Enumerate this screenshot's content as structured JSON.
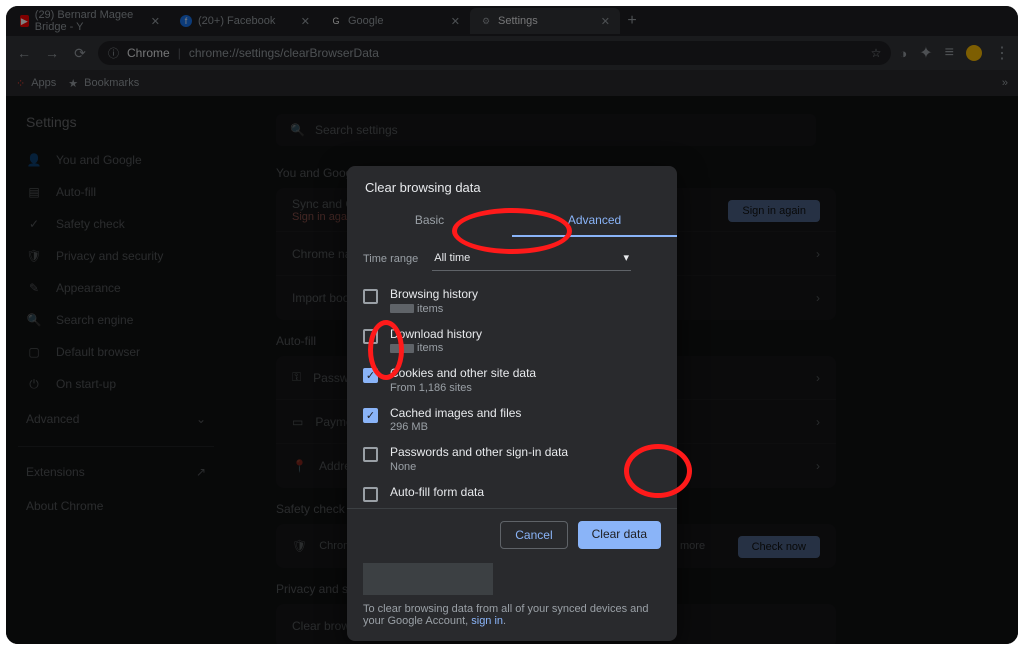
{
  "tabs": [
    {
      "favicon": "yt",
      "title": "(29) Bernard Magee Bridge - Y"
    },
    {
      "favicon": "fb",
      "title": "(20+) Facebook"
    },
    {
      "favicon": "g",
      "title": "Google"
    },
    {
      "favicon": "gear",
      "title": "Settings",
      "active": true
    }
  ],
  "omnibox": {
    "chrome_label": "Chrome",
    "path": "chrome://settings/clearBrowserData"
  },
  "bookmarks": {
    "apps": "Apps",
    "bookmarks": "Bookmarks"
  },
  "settings": {
    "title": "Settings",
    "sidebar": [
      {
        "icon": "person",
        "label": "You and Google"
      },
      {
        "icon": "autofill",
        "label": "Auto-fill"
      },
      {
        "icon": "shield",
        "label": "Safety check"
      },
      {
        "icon": "privacy",
        "label": "Privacy and security"
      },
      {
        "icon": "appearance",
        "label": "Appearance"
      },
      {
        "icon": "search",
        "label": "Search engine"
      },
      {
        "icon": "default",
        "label": "Default browser"
      },
      {
        "icon": "onstart",
        "label": "On start-up"
      }
    ],
    "advanced": "Advanced",
    "extensions": "Extensions",
    "about": "About Chrome",
    "search_placeholder": "Search settings",
    "sections": {
      "you": "You and Google",
      "sync": "Sync and Google services",
      "signin": "Sign in again",
      "chrome_name": "Chrome name and picture",
      "import": "Import bookmarks and settings",
      "sign_in_again_btn": "Sign in again",
      "autofill": "Auto-fill",
      "passwords": "Passwords",
      "payments": "Payment methods",
      "addresses": "Addresses and more",
      "safety": "Safety check",
      "chrome_can": "Chrome can help keep you safe from data breaches, bad extensions, and more",
      "check_now": "Check now",
      "privacy": "Privacy and security",
      "clear_browsing": "Clear browsing data"
    }
  },
  "modal": {
    "title": "Clear browsing data",
    "tabs": {
      "basic": "Basic",
      "advanced": "Advanced"
    },
    "time_range_label": "Time range",
    "time_range_value": "All time",
    "options": [
      {
        "checked": false,
        "l1": "Browsing history",
        "l2_items": "items",
        "bar": true
      },
      {
        "checked": false,
        "l1": "Download history",
        "l2_items": "items",
        "bar": true
      },
      {
        "checked": true,
        "l1": "Cookies and other site data",
        "l2": "From 1,186 sites"
      },
      {
        "checked": true,
        "l1": "Cached images and files",
        "l2": "296 MB"
      },
      {
        "checked": false,
        "l1": "Passwords and other sign-in data",
        "l2": "None"
      },
      {
        "checked": false,
        "l1": "Auto-fill form data",
        "l2": ""
      }
    ],
    "cancel": "Cancel",
    "clear": "Clear data",
    "footer_line1": "To clear browsing data from all of your synced devices and your Google Account,",
    "footer_link": "sign in"
  }
}
